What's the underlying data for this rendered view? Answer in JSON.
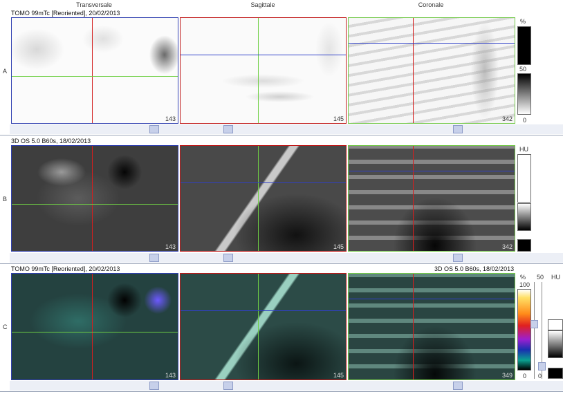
{
  "columns": {
    "transverse": "Transversale",
    "sagittal": "Sagittale",
    "coronal": "Coronale"
  },
  "rows": {
    "a": {
      "letter": "A",
      "title": "TOMO 99mTc [Reoriented], 20/02/2013"
    },
    "b": {
      "letter": "B",
      "title": "3D  OS  5.0  B60s, 18/02/2013"
    },
    "c": {
      "letter": "C",
      "title": "TOMO 99mTc [Reoriented], 20/02/2013",
      "title_right": "3D  OS  5.0  B60s, 18/02/2013"
    }
  },
  "slices": {
    "a": [
      "143",
      "145",
      "342"
    ],
    "b": [
      "143",
      "145",
      "342"
    ],
    "c": [
      "143",
      "145",
      "349"
    ]
  },
  "scales": {
    "a": {
      "unit": "%",
      "mid": "50",
      "min": "0"
    },
    "b": {
      "unit": "HU"
    },
    "c": {
      "unit_pct": "%",
      "max": "100",
      "min": "0",
      "win": "50",
      "unit_hu": "HU",
      "min2": "0"
    }
  },
  "colors": {
    "crosshair_red": "#d41f1f",
    "crosshair_green": "#6fcf44",
    "crosshair_blue": "#3040c8",
    "separator": "#9aa4b8"
  }
}
